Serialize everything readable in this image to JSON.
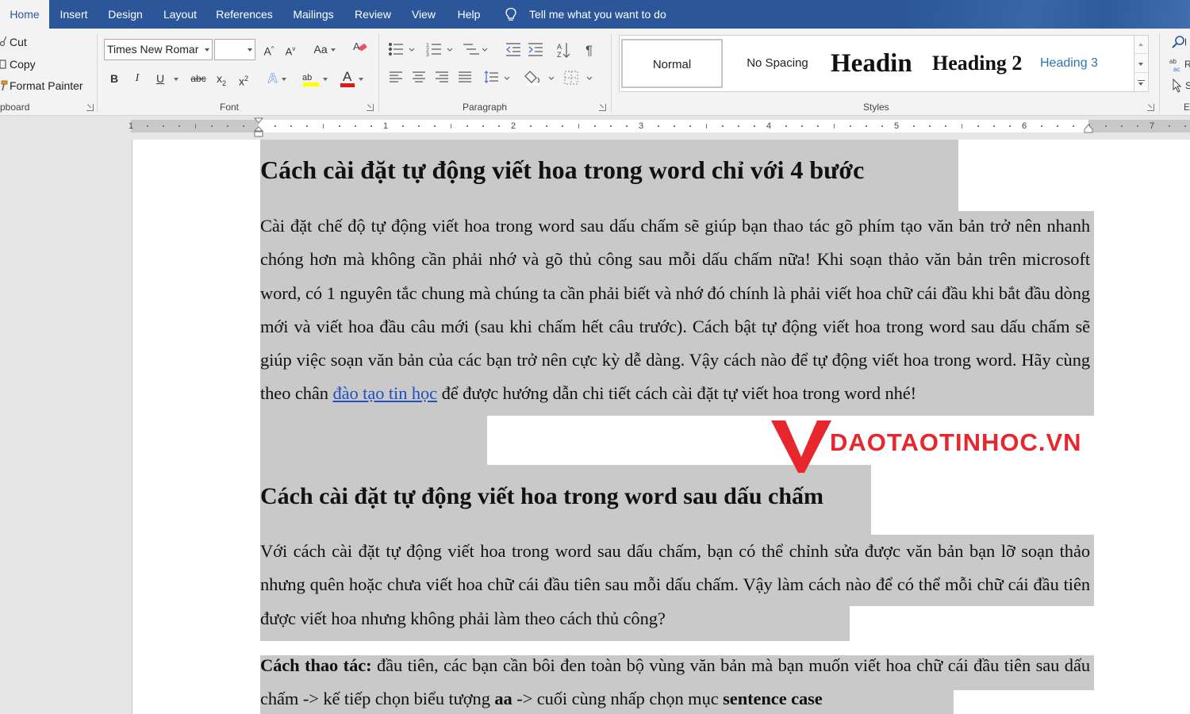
{
  "tabs": [
    {
      "label": "Home",
      "active": true
    },
    {
      "label": "Insert"
    },
    {
      "label": "Design"
    },
    {
      "label": "Layout"
    },
    {
      "label": "References"
    },
    {
      "label": "Mailings"
    },
    {
      "label": "Review"
    },
    {
      "label": "View"
    },
    {
      "label": "Help"
    }
  ],
  "tell_me": "Tell me what you want to do",
  "clipboard": {
    "cut": "Cut",
    "copy": "Copy",
    "format_painter": "Format Painter",
    "label": "pboard"
  },
  "font": {
    "name": "Times New Romar",
    "size": "",
    "label": "Font",
    "bold": "B",
    "italic": "I",
    "underline": "U",
    "strike": "abc",
    "change_case": "Aa",
    "grow": "A",
    "shrink": "A",
    "effects": "A",
    "highlight": "ab",
    "color": "A"
  },
  "paragraph": {
    "label": "Paragraph"
  },
  "styles": {
    "label": "Styles",
    "items": [
      {
        "label": "Normal"
      },
      {
        "label": "No Spacing"
      },
      {
        "label": "Headin"
      },
      {
        "label": "Heading 2"
      },
      {
        "label": "Heading 3"
      }
    ]
  },
  "editing": {
    "label": "E"
  },
  "ruler": {
    "numbers": [
      "1",
      "1",
      "2",
      "3",
      "4",
      "5",
      "6",
      "7"
    ]
  },
  "document": {
    "heading1": "Cách cài đặt tự động viết hoa trong word chỉ với 4 bước",
    "para1_before_link": "Cài đặt chế độ tự động viết hoa trong word sau dấu chấm sẽ giúp bạn thao tác gõ phím tạo văn bản trở nên nhanh chóng hơn mà không cần phải nhớ và gõ thủ công sau mỗi dấu chấm nữa! Khi soạn thảo văn bản trên microsoft word, có 1 nguyên tắc chung mà chúng ta cần phải biết và nhớ đó chính là phải viết hoa chữ cái đầu khi bắt đầu dòng mới và viết hoa đầu câu mới (sau khi chấm hết câu trước). Cách bật tự động viết hoa trong word sau dấu chấm sẽ giúp việc soạn văn bản của các bạn trở nên cực kỳ dễ dàng. Vậy cách nào để tự động viết hoa trong word. Hãy cùng theo chân ",
    "para1_link": "đào tạo tin học",
    "para1_after_link": " để được hướng dẫn chi tiết cách cài đặt tự viết hoa trong word nhé!",
    "heading2": "Cách cài đặt tự động viết hoa trong word sau dấu chấm",
    "para2": "Với cách cài đặt tự động viết hoa trong word sau dấu chấm, bạn có thể chỉnh sửa được văn bản bạn lỡ soạn thảo nhưng quên hoặc chưa viết hoa chữ cái đầu tiên sau mỗi dấu chấm. Vậy làm cách nào để có thể mỗi chữ cái đầu tiên được viết hoa nhưng không phải làm theo cách thủ công?",
    "para3_bold1": "Cách thao tác:",
    "para3_text1": " đầu tiên, các bạn cần bôi đen toàn bộ vùng văn bản mà bạn muốn viết hoa chữ cái đầu tiên sau dấu chấm -> kế tiếp chọn biểu tượng ",
    "para3_bold2": "aa",
    "para3_text2": " -> cuối cùng nhấp chọn mục ",
    "para3_bold3": "sentence case"
  },
  "watermark": {
    "text": "DAOTAOTINHOC.VN",
    "color": "#e8262d"
  },
  "colors": {
    "accent": "#2b579a",
    "selection": "#c9c9c9",
    "link": "#1f4fc2"
  }
}
